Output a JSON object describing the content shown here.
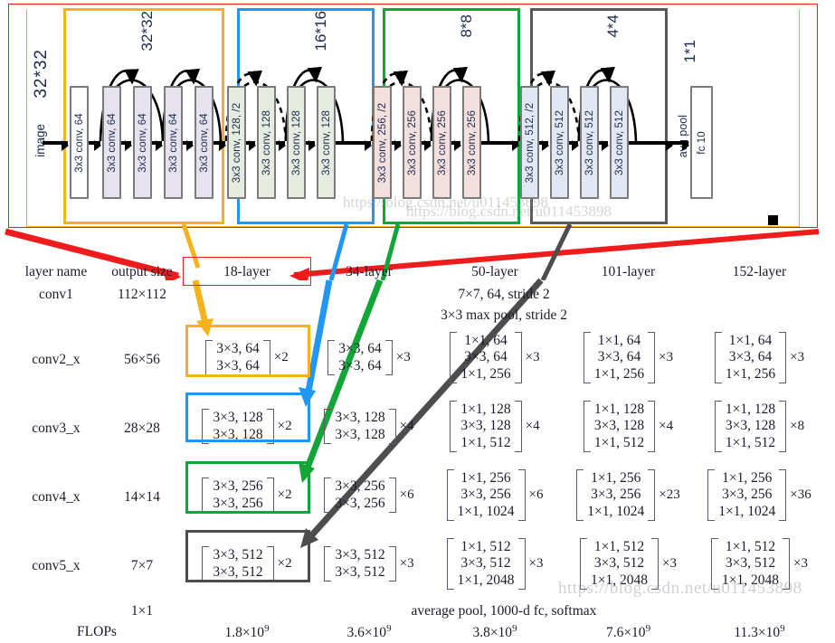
{
  "diagram": {
    "input_label": "image",
    "input_size": "32*32",
    "stage_sizes": [
      "32*32",
      "16*16",
      "8*8",
      "4*4",
      "1*1"
    ],
    "blocks": [
      {
        "label": "3x3 conv, 64",
        "fill": "white"
      },
      {
        "label": "3x3 conv, 64",
        "fill": "lavender"
      },
      {
        "label": "3x3 conv, 64",
        "fill": "lavender"
      },
      {
        "label": "3x3 conv, 64",
        "fill": "lavender"
      },
      {
        "label": "3x3 conv, 64",
        "fill": "lavender"
      },
      {
        "label": "3x3 conv, 128, /2",
        "fill": "green"
      },
      {
        "label": "3x3 conv, 128",
        "fill": "green"
      },
      {
        "label": "3x3 conv, 128",
        "fill": "green"
      },
      {
        "label": "3x3 conv, 128",
        "fill": "green"
      },
      {
        "label": "3x3 conv, 256, /2",
        "fill": "pink"
      },
      {
        "label": "3x3 conv, 256",
        "fill": "pink"
      },
      {
        "label": "3x3 conv, 256",
        "fill": "pink"
      },
      {
        "label": "3x3 conv, 256",
        "fill": "pink"
      },
      {
        "label": "3x3 conv, 512, /2",
        "fill": "blue"
      },
      {
        "label": "3x3 conv, 512",
        "fill": "blue"
      },
      {
        "label": "3x3 conv, 512",
        "fill": "blue"
      },
      {
        "label": "3x3 conv, 512",
        "fill": "blue"
      },
      {
        "label": "fc 10",
        "fill": "white"
      }
    ],
    "avg_pool_label": "avg pool",
    "group_colors": {
      "stage1": "#f5b21a",
      "stage2": "#2196f3",
      "stage3": "#13a538",
      "stage4": "#4d4d4d",
      "outer": "#ee1c1c"
    },
    "watermark": "https://blog.csdn.net/u011453898"
  },
  "table": {
    "headers": [
      "layer name",
      "output size",
      "18-layer",
      "34-layer",
      "50-layer",
      "101-layer",
      "152-layer"
    ],
    "rows": [
      {
        "layer_name": "conv1",
        "output_size": "112×112",
        "span_text": "7×7, 64, stride 2",
        "type": "span"
      },
      {
        "layer_name": "",
        "output_size": "",
        "span_text": "3×3 max pool, stride 2",
        "type": "span"
      },
      {
        "layer_name": "conv2_x",
        "output_size": "56×56",
        "type": "blocks",
        "cells": [
          {
            "lines": [
              "3×3, 64",
              "3×3, 64"
            ],
            "mult": "×2"
          },
          {
            "lines": [
              "3×3, 64",
              "3×3, 64"
            ],
            "mult": "×3"
          },
          {
            "lines": [
              "1×1, 64",
              "3×3, 64",
              "1×1, 256"
            ],
            "mult": "×3"
          },
          {
            "lines": [
              "1×1, 64",
              "3×3, 64",
              "1×1, 256"
            ],
            "mult": "×3"
          },
          {
            "lines": [
              "1×1, 64",
              "3×3, 64",
              "1×1, 256"
            ],
            "mult": "×3"
          }
        ]
      },
      {
        "layer_name": "conv3_x",
        "output_size": "28×28",
        "type": "blocks",
        "cells": [
          {
            "lines": [
              "3×3, 128",
              "3×3, 128"
            ],
            "mult": "×2"
          },
          {
            "lines": [
              "3×3, 128",
              "3×3, 128"
            ],
            "mult": "×4"
          },
          {
            "lines": [
              "1×1, 128",
              "3×3, 128",
              "1×1, 512"
            ],
            "mult": "×4"
          },
          {
            "lines": [
              "1×1, 128",
              "3×3, 128",
              "1×1, 512"
            ],
            "mult": "×4"
          },
          {
            "lines": [
              "1×1, 128",
              "3×3, 128",
              "1×1, 512"
            ],
            "mult": "×8"
          }
        ]
      },
      {
        "layer_name": "conv4_x",
        "output_size": "14×14",
        "type": "blocks",
        "cells": [
          {
            "lines": [
              "3×3, 256",
              "3×3, 256"
            ],
            "mult": "×2"
          },
          {
            "lines": [
              "3×3, 256",
              "3×3, 256"
            ],
            "mult": "×6"
          },
          {
            "lines": [
              "1×1, 256",
              "3×3, 256",
              "1×1, 1024"
            ],
            "mult": "×6"
          },
          {
            "lines": [
              "1×1, 256",
              "3×3, 256",
              "1×1, 1024"
            ],
            "mult": "×23"
          },
          {
            "lines": [
              "1×1, 256",
              "3×3, 256",
              "1×1, 1024"
            ],
            "mult": "×36"
          }
        ]
      },
      {
        "layer_name": "conv5_x",
        "output_size": "7×7",
        "type": "blocks",
        "cells": [
          {
            "lines": [
              "3×3, 512",
              "3×3, 512"
            ],
            "mult": "×2"
          },
          {
            "lines": [
              "3×3, 512",
              "3×3, 512"
            ],
            "mult": "×3"
          },
          {
            "lines": [
              "1×1, 512",
              "3×3, 512",
              "1×1, 2048"
            ],
            "mult": "×3"
          },
          {
            "lines": [
              "1×1, 512",
              "3×3, 512",
              "1×1, 2048"
            ],
            "mult": "×3"
          },
          {
            "lines": [
              "1×1, 512",
              "3×3, 512",
              "1×1, 2048"
            ],
            "mult": "×3"
          }
        ]
      },
      {
        "layer_name": "",
        "output_size": "1×1",
        "span_text": "average pool, 1000-d fc, softmax",
        "type": "span"
      }
    ],
    "flops_label": "FLOPs",
    "flops": [
      "1.8×10",
      "3.6×10",
      "3.8×10",
      "7.6×10",
      "11.3×10"
    ],
    "flops_exponent": "9"
  },
  "annotations": {
    "highlight_18layer_header": "18-layer",
    "watermark": "https://blog.csdn.net/u011453898"
  }
}
